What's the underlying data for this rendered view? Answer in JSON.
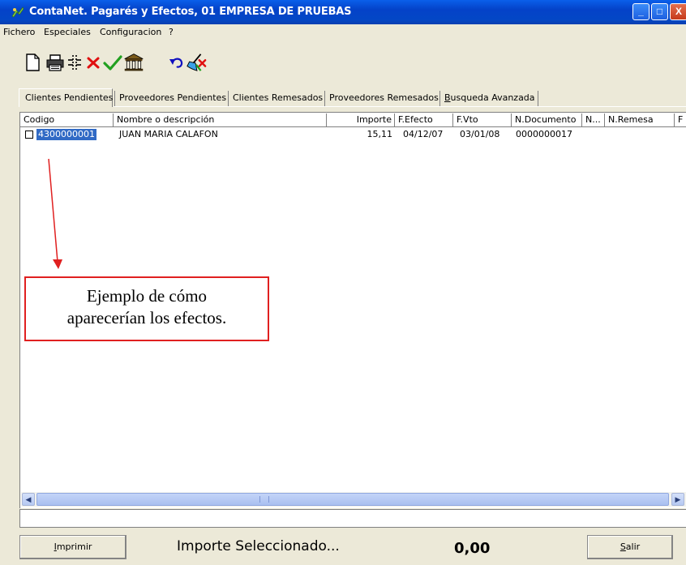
{
  "window": {
    "title": "ContaNet. Pagarés y Efectos, 01 EMPRESA DE PRUEBAS",
    "controls": {
      "minimize": "_",
      "maximize": "□",
      "close": "X"
    }
  },
  "menu": [
    "Fichero",
    "Especiales",
    "Configuracion",
    "?"
  ],
  "toolbar": {
    "icons": [
      "new-document-icon",
      "print-icon",
      "columns-icon",
      "delete-icon",
      "confirm-icon",
      "bank-icon",
      "undo-icon",
      "broom-icon"
    ]
  },
  "tabs": [
    {
      "label": "Clientes Pendientes",
      "active": true
    },
    {
      "label": "Proveedores Pendientes"
    },
    {
      "label": "Clientes Remesados"
    },
    {
      "label": "Proveedores Remesados"
    },
    {
      "label": "Busqueda Avanzada"
    }
  ],
  "table": {
    "columns": [
      "Codigo",
      "Nombre o descripción",
      "Importe",
      "F.Efecto",
      "F.Vto",
      "N.Documento",
      "N...",
      "N.Remesa",
      "F"
    ],
    "rows": [
      {
        "codigo": "4300000001",
        "nombre": "JUAN MARIA CALAFON",
        "importe": "15,11",
        "f_efecto": "04/12/07",
        "f_vto": "03/01/08",
        "n_documento": "0000000017",
        "checked": false
      }
    ]
  },
  "annotation": {
    "line1": "Ejemplo de cómo",
    "line2": "aparecerían los efectos.",
    "color": "#E02020"
  },
  "footer": {
    "print_label": "Imprimir",
    "selected_label": "Importe Seleccionado...",
    "selected_value": "0,00",
    "exit_label": "Salir"
  },
  "colors": {
    "titlebar": "#0442C8",
    "selection": "#316AC5",
    "window_bg": "#ECE9D8"
  }
}
